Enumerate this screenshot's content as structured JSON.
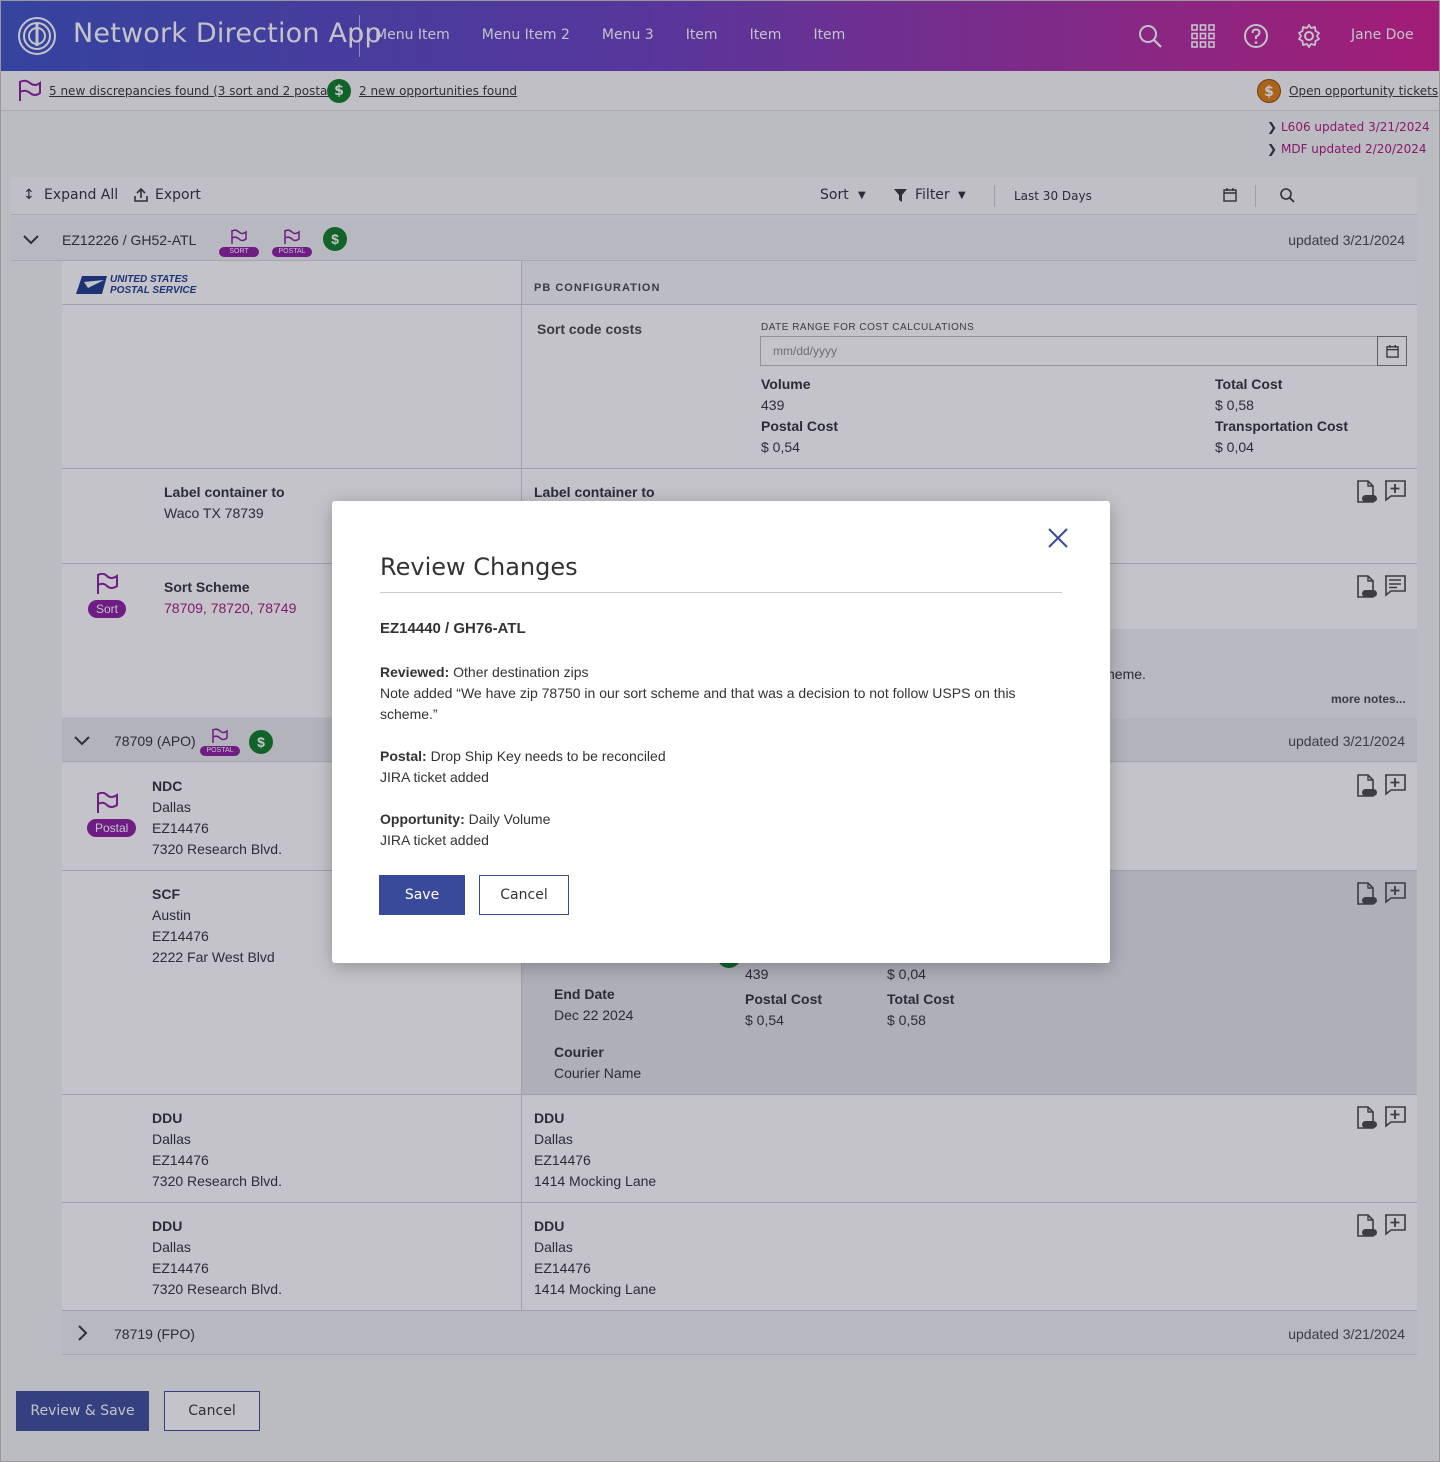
{
  "app": {
    "title": "Network Direction App",
    "user": "Jane Doe",
    "nav": [
      "Menu Item",
      "Menu Item 2",
      "Menu 3",
      "Item",
      "Item",
      "Item"
    ]
  },
  "notices": {
    "discrepancies": "5 new discrepancies found (3 sort and 2 postal)",
    "opportunities": "2 new opportunities found",
    "open_tickets": "Open opportunity tickets",
    "dollar": "$"
  },
  "updates": [
    "L606 updated 3/21/2024",
    "MDF updated 2/20/2024"
  ],
  "toolbar": {
    "expand_all": "Expand All",
    "export": "Export",
    "sort": "Sort",
    "filter": "Filter",
    "date_range": "Last 30 Days"
  },
  "group1": {
    "title": "EZ12226 / GH52-ATL",
    "updated": "updated 3/21/2024",
    "sort_badge": "SORT",
    "postal_badge": "POSTAL"
  },
  "usps": {
    "line1": "UNITED STATES",
    "line2": "POSTAL SERVICE"
  },
  "pb_config": {
    "header": "PB CONFIGURATION",
    "sort_code_costs": "Sort code costs",
    "date_range_label": "DATE RANGE FOR COST CALCULATIONS",
    "date_placeholder": "mm/dd/yyyy",
    "volume_label": "Volume",
    "volume": "439",
    "total_cost_label": "Total Cost",
    "total_cost": "$ 0,58",
    "postal_cost_label": "Postal Cost",
    "postal_cost": "$ 0,54",
    "transport_cost_label": "Transportation Cost",
    "transport_cost": "$ 0,04"
  },
  "label_container": {
    "label": "Label container to",
    "value": "Waco TX 78739",
    "right_label": "Label container to"
  },
  "sort_scheme": {
    "badge": "Sort",
    "label": "Sort Scheme",
    "value": "78709, 78720, 78749",
    "note_tail": "heme.",
    "more_notes": "more notes..."
  },
  "group2": {
    "title": "78709 (APO)",
    "updated": "updated 3/21/2024",
    "postal_badge": "POSTAL"
  },
  "ndc": {
    "badge": "Postal",
    "label": "NDC",
    "city": "Dallas",
    "code": "EZ14476",
    "address": "7320 Research Blvd."
  },
  "scf": {
    "label": "SCF",
    "city": "Austin",
    "code": "EZ14476",
    "address": "2222 Far West Blvd",
    "volume": "439",
    "transport": "$ 0,04",
    "end_date_label": "End Date",
    "end_date": "Dec 22 2024",
    "postal_cost_label": "Postal Cost",
    "postal_cost": "$ 0,54",
    "total_cost_label": "Total Cost",
    "total_cost": "$ 0,58",
    "courier_label": "Courier",
    "courier": "Courier Name"
  },
  "ddu_rows": [
    {
      "left": {
        "label": "DDU",
        "city": "Dallas",
        "code": "EZ14476",
        "address": "7320 Research Blvd."
      },
      "right": {
        "label": "DDU",
        "city": "Dallas",
        "code": "EZ14476",
        "address": "1414 Mocking Lane"
      }
    },
    {
      "left": {
        "label": "DDU",
        "city": "Dallas",
        "code": "EZ14476",
        "address": "7320 Research Blvd."
      },
      "right": {
        "label": "DDU",
        "city": "Dallas",
        "code": "EZ14476",
        "address": "1414 Mocking Lane"
      }
    }
  ],
  "group3": {
    "title": "78719 (FPO)",
    "updated": "updated 3/21/2024"
  },
  "footer": {
    "review_save": "Review & Save",
    "cancel": "Cancel"
  },
  "modal": {
    "title": "Review Changes",
    "subtitle": "EZ14440 / GH76-ATL",
    "reviewed_label": "Reviewed:",
    "reviewed_value": " Other destination zips",
    "reviewed_note": "Note added “We have zip 78750 in our sort scheme and that was a decision to not follow USPS on this scheme.”",
    "postal_label": "Postal:",
    "postal_value": " Drop Ship Key needs to be reconciled",
    "postal_note": "JIRA ticket added",
    "opportunity_label": "Opportunity:",
    "opportunity_value": " Daily Volume",
    "opportunity_note": "JIRA ticket added",
    "save": "Save",
    "cancel": "Cancel"
  },
  "colors": {
    "header_start": "#3a4fc4",
    "header_end": "#d21a8d",
    "flag_purple": "#8b1aa0",
    "dollar_green": "#0a7a22",
    "dollar_orange": "#e07a10",
    "primary_button": "#3a4a9a",
    "link_magenta": "#b0127a"
  },
  "icons": [
    "logo-icon",
    "search-icon",
    "apps-grid-icon",
    "help-icon",
    "settings-icon",
    "flag-icon",
    "dollar-icon",
    "chevron-right-icon",
    "expand-icon",
    "export-icon",
    "caret-down-icon",
    "filter-icon",
    "calendar-icon",
    "chevron-down-icon",
    "jira-doc-icon",
    "add-note-icon",
    "comment-icon",
    "close-icon"
  ]
}
